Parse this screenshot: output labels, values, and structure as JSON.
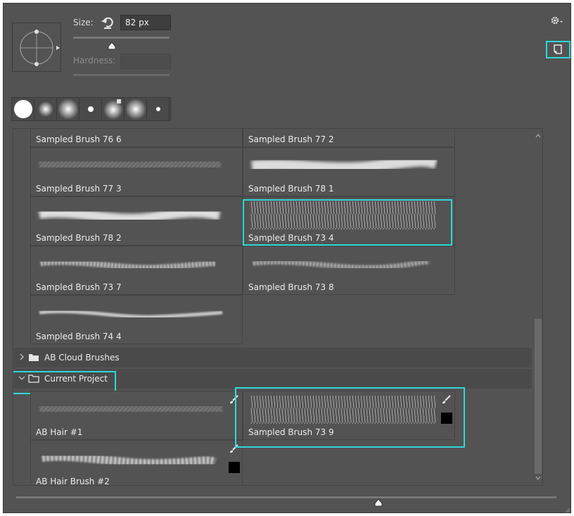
{
  "size": {
    "label": "Size:",
    "value": "82 px",
    "slider_fraction": 0.4
  },
  "hardness": {
    "label": "Hardness:",
    "value": ""
  },
  "presets": [
    {
      "kind": "hard"
    },
    {
      "kind": "soft"
    },
    {
      "kind": "soft-large"
    },
    {
      "kind": "dot"
    },
    {
      "kind": "soft-badge"
    },
    {
      "kind": "soft-large"
    },
    {
      "kind": "dot"
    }
  ],
  "brushes": [
    {
      "label": "Sampled Brush 76 6",
      "stroke": "partial"
    },
    {
      "label": "Sampled Brush 77 2",
      "stroke": "partial"
    },
    {
      "label": "Sampled Brush 77 3",
      "stroke": "hair-thin"
    },
    {
      "label": "Sampled Brush 78 1",
      "stroke": "cloud"
    },
    {
      "label": "Sampled Brush 78 2",
      "stroke": "cloud"
    },
    {
      "label": "Sampled Brush 73 4",
      "stroke": "fur"
    },
    {
      "label": "Sampled Brush 73 7",
      "stroke": "chalk"
    },
    {
      "label": "Sampled Brush 73 8",
      "stroke": "chalk"
    },
    {
      "label": "Sampled Brush 74 4",
      "stroke": "soft-line"
    }
  ],
  "folders": [
    {
      "name": "AB Cloud Brushes",
      "expanded": false
    },
    {
      "name": "Current Project",
      "expanded": true
    }
  ],
  "project_brushes": [
    {
      "label": "AB Hair #1",
      "stroke": "hair"
    },
    {
      "label": "Sampled Brush 73 9",
      "stroke": "fur"
    },
    {
      "label": "AB Hair Brush #2",
      "stroke": "hair-dots"
    }
  ],
  "colors": {
    "highlight": "#2fd7d7",
    "panel": "#535353"
  },
  "icons": {
    "gear": "gear-icon",
    "new_preset": "new-preset-icon",
    "reset": "reset-icon",
    "brush_tool": "brush-tool-icon",
    "folder": "folder-icon"
  }
}
